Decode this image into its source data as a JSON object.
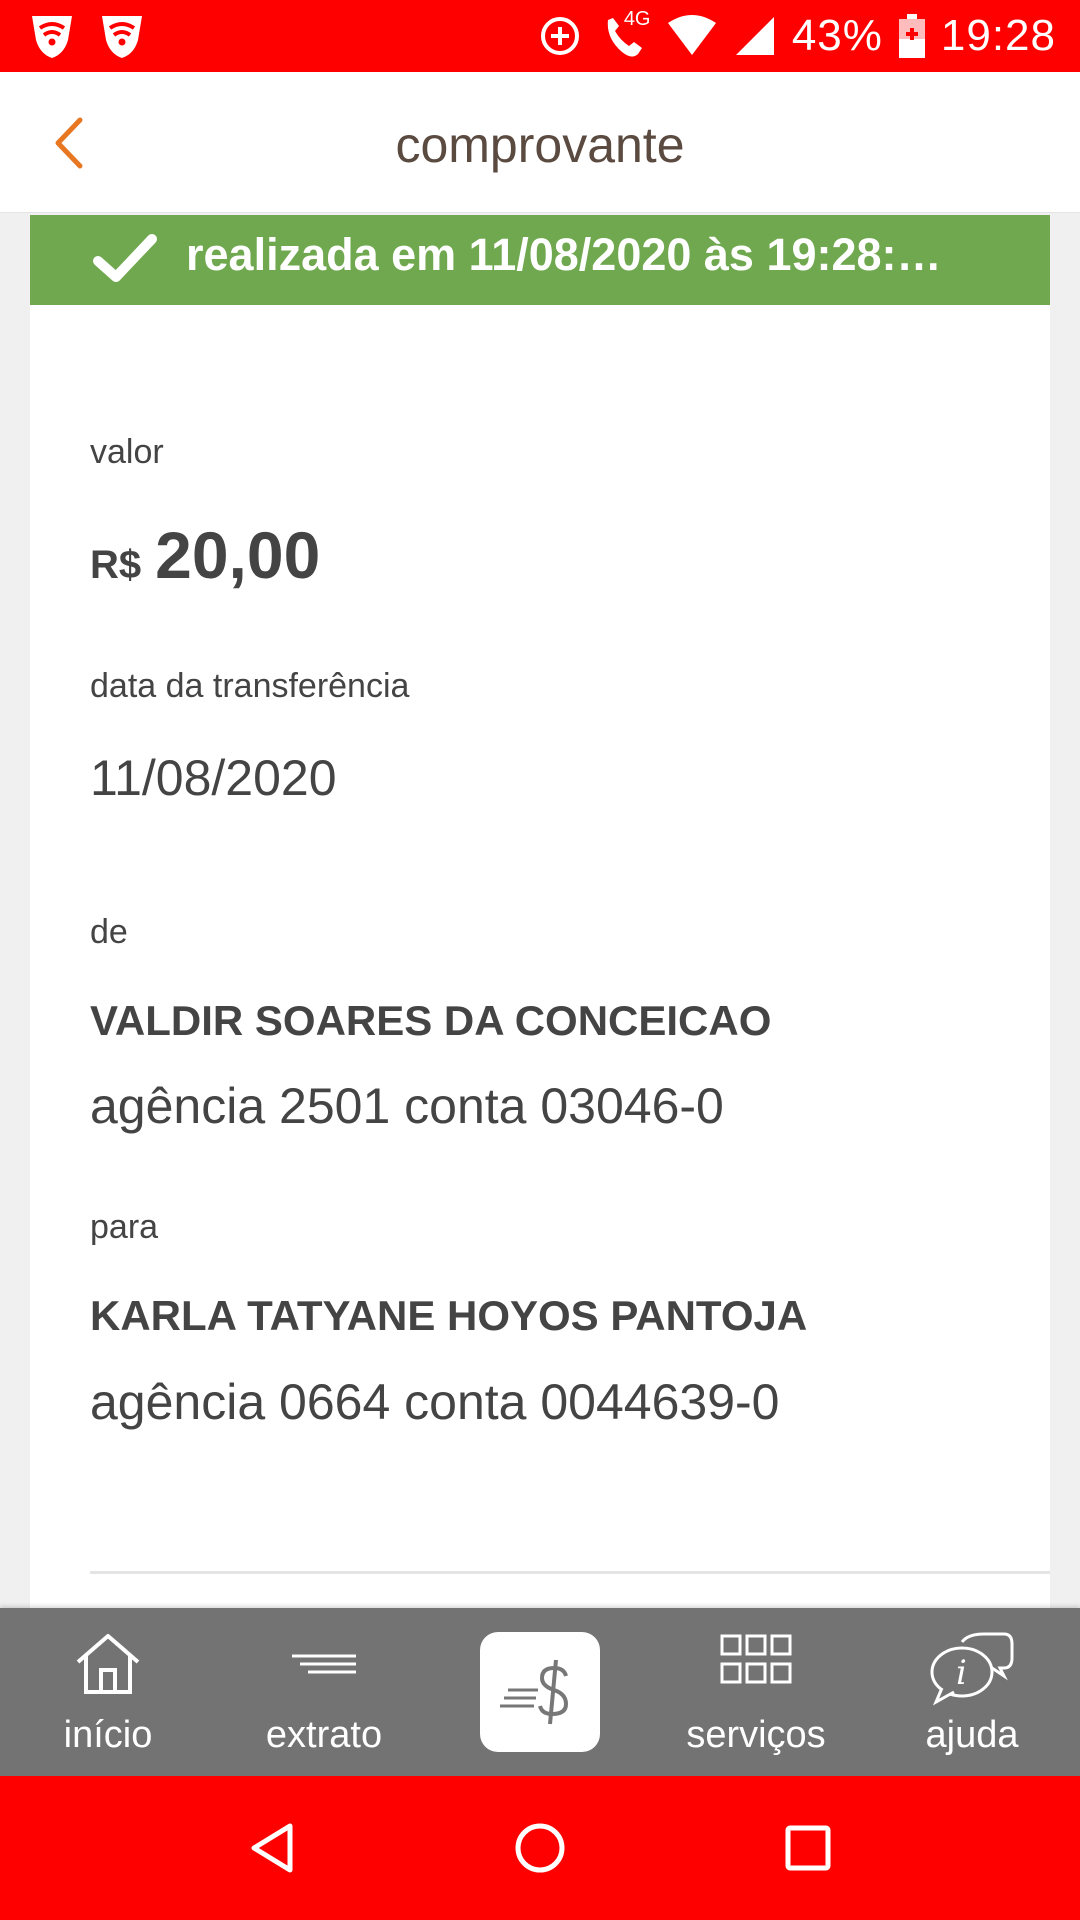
{
  "status_bar": {
    "battery": "43%",
    "time": "19:28",
    "network_type": "4G",
    "icons": [
      "notification-shield-icon",
      "notification-shield-icon",
      "data-saver-icon",
      "volte-call-icon",
      "wifi-icon",
      "cell-signal-icon",
      "battery-icon"
    ]
  },
  "header": {
    "title": "comprovante",
    "back_icon": "chevron-left-icon"
  },
  "receipt": {
    "status_text": "realizada em 11/08/2020 às 19:28:…",
    "status_icon": "checkmark-icon",
    "amount_label": "valor",
    "currency": "R$",
    "amount": "20,00",
    "date_label": "data da transferência",
    "date": "11/08/2020",
    "from_label": "de",
    "from_name": "VALDIR SOARES DA CONCEICAO",
    "from_account": "agência 2501 conta 03046-0",
    "to_label": "para",
    "to_name": "KARLA TATYANE HOYOS PANTOJA",
    "to_account": "agência 0664 conta 0044639-0"
  },
  "bottom_nav": {
    "items": [
      {
        "label": "início",
        "icon": "home-icon"
      },
      {
        "label": "extrato",
        "icon": "statement-lines-icon"
      },
      {
        "label": "",
        "icon": "transfer-money-icon"
      },
      {
        "label": "serviços",
        "icon": "grid-icon"
      },
      {
        "label": "ajuda",
        "icon": "help-chat-icon"
      }
    ]
  },
  "colors": {
    "brand_red": "#ff0000",
    "success_green": "#6fa84e",
    "nav_gray": "#737373",
    "back_orange": "#e87722"
  }
}
